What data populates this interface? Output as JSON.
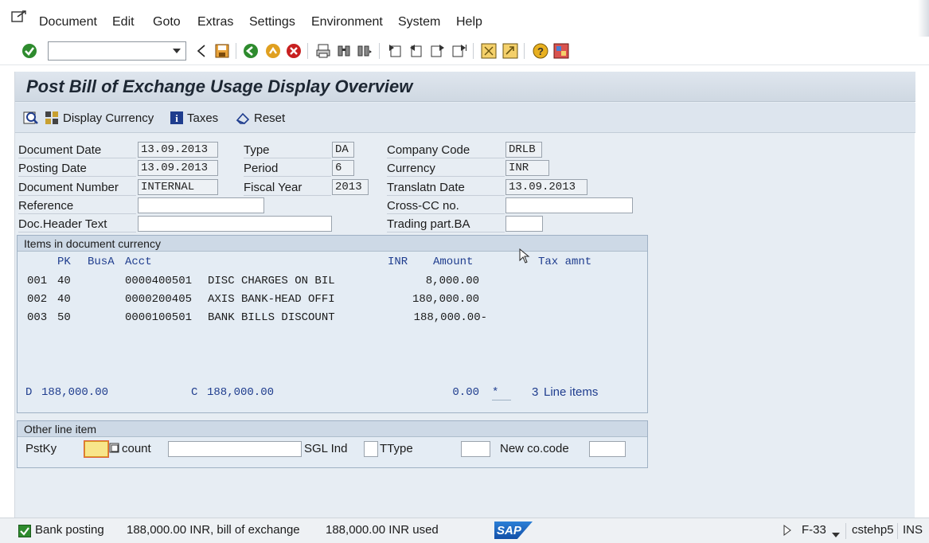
{
  "menu": {
    "items": [
      "Document",
      "Edit",
      "Goto",
      "Extras",
      "Settings",
      "Environment",
      "System",
      "Help"
    ]
  },
  "toolbar": {
    "command_field_value": "",
    "icons": [
      "enter-icon",
      "back-icon",
      "save-icon",
      "exit-icon",
      "cancel-icon",
      "print-icon",
      "find-icon",
      "find-next-icon",
      "first-page-icon",
      "previous-page-icon",
      "next-page-icon",
      "last-page-icon",
      "create-session-icon",
      "shortcut-icon",
      "help-icon",
      "layout-menu-icon"
    ]
  },
  "title": "Post Bill of Exchange Usage Display Overview",
  "app_toolbar": {
    "display_currency": "Display Currency",
    "taxes": "Taxes",
    "reset": "Reset"
  },
  "header": {
    "document_date_label": "Document Date",
    "document_date": "13.09.2013",
    "posting_date_label": "Posting Date",
    "posting_date": "13.09.2013",
    "document_number_label": "Document Number",
    "document_number": "INTERNAL",
    "reference_label": "Reference",
    "reference": "",
    "doc_header_text_label": "Doc.Header Text",
    "doc_header_text": "",
    "type_label": "Type",
    "type": "DA",
    "period_label": "Period",
    "period": "6",
    "fiscal_year_label": "Fiscal Year",
    "fiscal_year": "2013",
    "company_code_label": "Company Code",
    "company_code": "DRLB",
    "currency_label": "Currency",
    "currency": "INR",
    "translation_date_label": "Translatn Date",
    "translation_date": "13.09.2013",
    "cross_cc_label": "Cross-CC no.",
    "cross_cc": "",
    "trading_part_label": "Trading part.BA",
    "trading_part": ""
  },
  "items": {
    "title": "Items in document currency",
    "columns": {
      "pk": "PK",
      "busa": "BusA",
      "acct": "Acct",
      "currency": "INR",
      "amount": "Amount",
      "tax": "Tax amnt"
    },
    "rows": [
      {
        "no": "001",
        "pk": "40",
        "acct": "0000400501",
        "text": "DISC CHARGES ON BIL",
        "amount": "8,000.00"
      },
      {
        "no": "002",
        "pk": "40",
        "acct": "0000200405",
        "text": "AXIS BANK-HEAD OFFI",
        "amount": "180,000.00"
      },
      {
        "no": "003",
        "pk": "50",
        "acct": "0000100501",
        "text": "BANK BILLS DISCOUNT",
        "amount": "188,000.00-"
      }
    ],
    "totals": {
      "debit_label": "D",
      "debit": "188,000.00",
      "credit_label": "C",
      "credit": "188,000.00",
      "balance": "0.00",
      "balance_flag": "*",
      "line_items_count": "3",
      "line_items_label": "Line items"
    }
  },
  "other_line": {
    "title": "Other line item",
    "pstky_label": "PstKy",
    "pstky_value": "",
    "account_label": "count",
    "account_value": "",
    "sgl_label": "SGL Ind",
    "sgl_value": "",
    "ttype_label": "TType",
    "ttype_value": "",
    "new_co_label": "New co.code",
    "new_co_value": ""
  },
  "status": {
    "message": "Bank posting",
    "detail1": "188,000.00 INR, bill of exchange",
    "detail2": "188,000.00 INR used",
    "logo": "SAP",
    "transaction": "F-33",
    "server": "cstehp5",
    "mode": "INS"
  },
  "colors": {
    "accent_blue": "#1f3d8e",
    "panel_bg": "#e4ecf4",
    "ok_green": "#2e8b2e"
  }
}
